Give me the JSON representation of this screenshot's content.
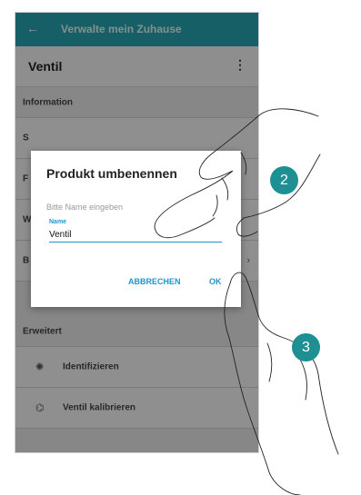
{
  "appbar": {
    "title": "Verwalte mein Zuhause"
  },
  "header": {
    "title": "Ventil",
    "menu_glyph": "⋮"
  },
  "list": {
    "information_label": "Information",
    "row_seriennummer_partial": "S",
    "row_f_partial": "F",
    "row_w_partial": "W",
    "row_b_partial": "B",
    "erweitert_label": "Erweitert",
    "identify_label": "Identifizieren",
    "calibrate_label": "Ventil kalibrieren"
  },
  "dialog": {
    "title": "Produkt umbenennen",
    "hint": "Bitte Name eingeben",
    "field_label": "Name",
    "field_value": "Ventil",
    "cancel_label": "ABBRECHEN",
    "ok_label": "OK"
  },
  "callouts": {
    "step_rename": "2",
    "step_ok": "3"
  },
  "colors": {
    "appbar": "#26a4b0",
    "accent": "#2196c8",
    "badge": "#1e8f93"
  },
  "icons": {
    "back": "arrow-left-icon",
    "menu": "more-vert-icon",
    "identify": "sparkle-icon",
    "calibrate": "valve-icon"
  }
}
